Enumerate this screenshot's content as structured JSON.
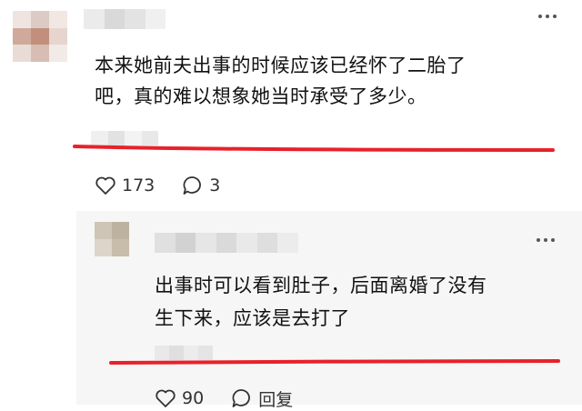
{
  "comment": {
    "text_lines": [
      "本来她前夫出事的时候应该已经怀了二胎了",
      "吧，真的难以想象她当时承受了多少。"
    ],
    "likes": "173",
    "replies": "3",
    "like_icon": "heart-icon",
    "reply_icon": "speech-bubble-icon",
    "more_icon": "more-dots-icon"
  },
  "reply": {
    "text_lines": [
      "出事时可以看到肚子，后面离婚了没有",
      "生下来，应该是去打了"
    ],
    "likes": "90",
    "reply_label": "回复",
    "like_icon": "heart-icon",
    "reply_icon": "speech-bubble-icon",
    "more_icon": "more-dots-icon"
  },
  "colors": {
    "underline": "#e8212a",
    "reply_background": "#f6f6f6",
    "text": "#111111"
  }
}
